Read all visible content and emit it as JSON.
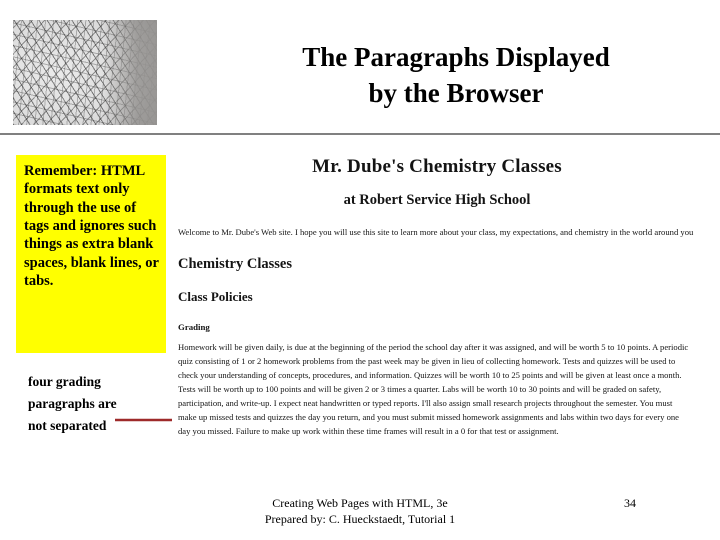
{
  "slide": {
    "title_line1": "The Paragraphs Displayed",
    "title_line2": "by the Browser",
    "header_image_alt": "texture-photo"
  },
  "callout": {
    "text": "Remember: HTML formats text only through the use of tags and ignores such things as extra blank spaces, blank lines, or tabs."
  },
  "annotation": {
    "text": "four grading paragraphs are not separated",
    "arrow_color": "#9E2A2A"
  },
  "browser_page": {
    "heading1": "Mr. Dube's Chemistry Classes",
    "heading2": "at Robert Service High School",
    "intro": "Welcome to Mr. Dube's Web site. I hope you will use this site to learn more about your class, my expectations, and chemistry in the world around you",
    "heading3": "Chemistry Classes",
    "heading4": "Class Policies",
    "heading5": "Grading",
    "body": "Homework will be given daily, is due at the beginning of the period the school day after it was assigned, and will be worth 5 to 10 points. A periodic quiz consisting of 1 or 2 homework problems from the past week may be given in lieu of collecting homework. Tests and quizzes will be used to check your understanding of concepts, procedures, and information. Quizzes will be worth 10 to 25 points and will be given at least once a month. Tests will be worth up to 100 points and will be given 2 or 3 times a quarter. Labs will be worth 10 to 30 points and will be graded on safety, participation, and write-up. I expect neat handwritten or typed reports. I'll also assign small research projects throughout the semester. You must make up missed tests and quizzes the day you return, and you must submit missed homework assignments and labs within two days for every one day you missed. Failure to make up work within these time frames will result in a 0 for that test or assignment."
  },
  "footer": {
    "line1": "Creating Web Pages with HTML, 3e",
    "line2": "Prepared by: C. Hueckstaedt, Tutorial 1",
    "page_number": "34"
  },
  "colors": {
    "callout_background": "#FFFF00",
    "divider": "#808080",
    "arrow": "#9E2A2A"
  }
}
